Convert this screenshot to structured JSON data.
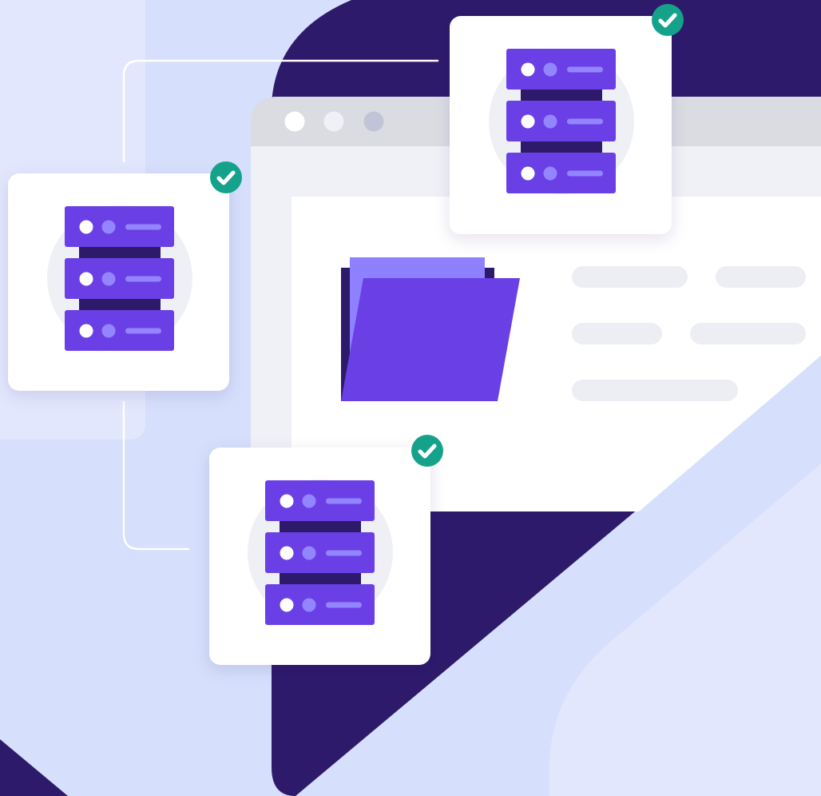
{
  "illustration": {
    "subject": "server-backup-sync",
    "server_count": 3,
    "servers_status": [
      "ok",
      "ok",
      "ok"
    ],
    "icons": [
      "server-rack-icon",
      "check-circle-icon",
      "folder-icon",
      "browser-window-icon"
    ]
  },
  "colors": {
    "background": "#D6DFFB",
    "background_light": "#E3E7FD",
    "dark_shape": "#2E1A6B",
    "browser_frame": "#DBDCE2",
    "browser_window": "#F0F1F6",
    "card": "#FFFFFF",
    "card_halo": "#EFEFF6",
    "server_unit": "#6A40E6",
    "server_accent": "#9385FF",
    "server_shadow": "#2E1A6B",
    "folder_front": "#6A40E6",
    "folder_back": "#8E80FF",
    "check_green": "#14A38A",
    "placeholder_bar": "#EDEEF3",
    "traffic_light": "#C0C4D6",
    "connector_line": "#FFFFFF"
  }
}
